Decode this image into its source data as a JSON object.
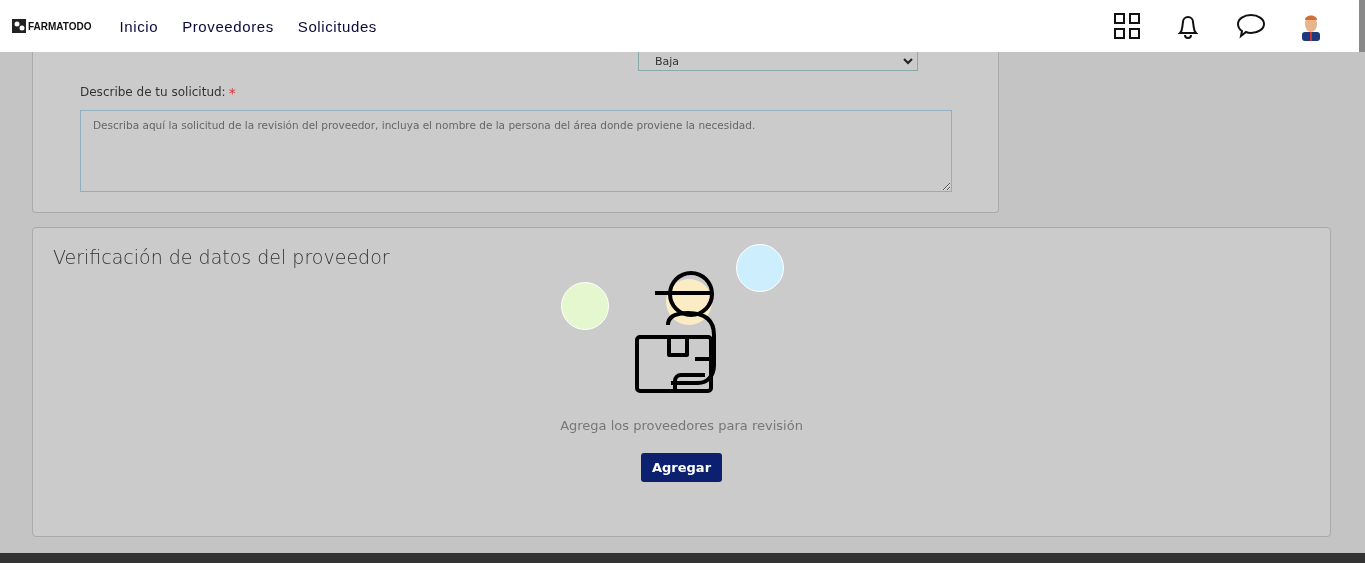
{
  "header": {
    "logo": "FARMATODO",
    "nav": [
      {
        "label": "Inicio"
      },
      {
        "label": "Proveedores"
      },
      {
        "label": "Solicitudes"
      }
    ]
  },
  "request_form": {
    "priority": {
      "value": "Baja"
    },
    "description": {
      "label": "Describe de tu solicitud:",
      "required_mark": "*",
      "placeholder": "Describa aquí la solicitud de la revisión del proveedor, incluya el nombre de la persona del área donde proviene la necesidad."
    }
  },
  "verification": {
    "title": "Verificación de datos del proveedor",
    "empty_message": "Agrega los proveedores para revisión",
    "button": "Agregar"
  }
}
